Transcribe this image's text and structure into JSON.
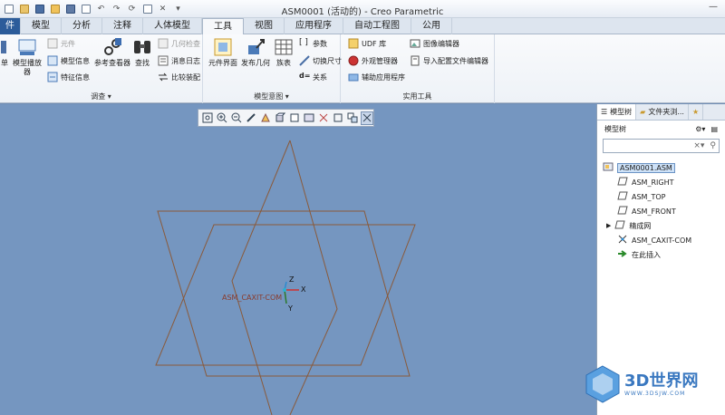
{
  "window": {
    "title": "ASM0001 (活动的) - Creo Parametric"
  },
  "tabs": [
    {
      "label": "件"
    },
    {
      "label": "模型"
    },
    {
      "label": "分析"
    },
    {
      "label": "注释"
    },
    {
      "label": "人体模型"
    },
    {
      "label": "工具"
    },
    {
      "label": "视图"
    },
    {
      "label": "应用程序"
    },
    {
      "label": "自动工程图"
    },
    {
      "label": "公用"
    }
  ],
  "active_tab": "工具",
  "ribbon": {
    "investigate": {
      "label": "调查",
      "single": "单",
      "model_player": "模型播放器",
      "component": "元件",
      "model_info": "模型信息",
      "feature_info": "特征信息",
      "ref_viewer": "参考查看器",
      "find": "查找",
      "geom_check": "几何检查",
      "message_log": "消息日志",
      "compare_assembly": "比较装配"
    },
    "model_intent": {
      "label": "模型意图",
      "component_interface": "元件界面",
      "publish_geometry": "发布几何",
      "family_table": "族表",
      "parameters": "参数",
      "switch_dims": "切换尺寸",
      "relations": "关系"
    },
    "utilities": {
      "label": "实用工具",
      "udf_library": "UDF 库",
      "external_manager": "外观管理器",
      "aux_apps": "辅助应用程序",
      "image_editor": "图像编辑器",
      "import_config_editor": "导入配置文件编辑器"
    }
  },
  "viewport": {
    "csys_label": "ASM_CAXIT-COM",
    "axis_x": "X",
    "axis_y": "Y",
    "axis_z": "Z"
  },
  "panel": {
    "tab_model_tree": "模型树",
    "tab_folder": "文件夹浏...",
    "toolbar_label": "模型树",
    "tree": [
      {
        "label": "ASM0001.ASM",
        "icon": "assembly-icon"
      },
      {
        "label": "ASM_RIGHT",
        "icon": "datum-plane-icon"
      },
      {
        "label": "ASM_TOP",
        "icon": "datum-plane-icon"
      },
      {
        "label": "ASM_FRONT",
        "icon": "datum-plane-icon"
      },
      {
        "label": "精成网",
        "icon": "datum-plane-icon"
      },
      {
        "label": "ASM_CAXIT-COM",
        "icon": "csys-icon"
      },
      {
        "label": "在此插入",
        "icon": "insert-arrow-icon"
      }
    ]
  },
  "watermark": {
    "title": "3D世界网",
    "sub": "WWW.3DSJW.COM"
  },
  "colors": {
    "viewport": "#7596c0",
    "datum": "#8a5a3a",
    "accent": "#2c5c9a"
  }
}
